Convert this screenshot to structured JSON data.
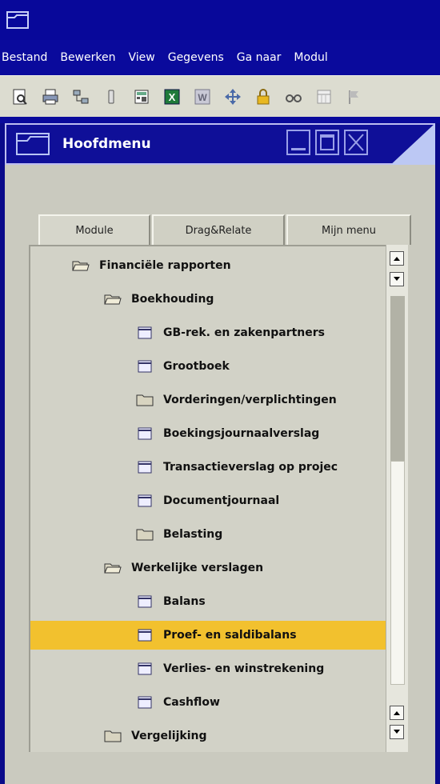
{
  "menubar": {
    "items": [
      "Bestand",
      "Bewerken",
      "View",
      "Gegevens",
      "Ga naar",
      "Modul"
    ]
  },
  "toolbar": {
    "icons": [
      "print-preview-icon",
      "print-icon",
      "network-icon",
      "phone-icon",
      "calculator-icon",
      "excel-icon",
      "word-icon",
      "move-icon",
      "lock-icon",
      "binoculars-icon",
      "calendar-icon",
      "flag-icon"
    ]
  },
  "window": {
    "title": "Hoofdmenu"
  },
  "tabs": [
    {
      "label": "Module",
      "active": true
    },
    {
      "label": "Drag&Relate",
      "active": false
    },
    {
      "label": "Mijn menu",
      "active": false
    }
  ],
  "tree": [
    {
      "label": "Financiële rapporten",
      "icon": "folder-open-icon",
      "level": 0,
      "selected": false
    },
    {
      "label": "Boekhouding",
      "icon": "folder-open-icon",
      "level": 1,
      "selected": false
    },
    {
      "label": "GB-rek. en zakenpartners",
      "icon": "form-icon",
      "level": 2,
      "selected": false
    },
    {
      "label": "Grootboek",
      "icon": "form-icon",
      "level": 2,
      "selected": false
    },
    {
      "label": "Vorderingen/verplichtingen",
      "icon": "folder-closed-icon",
      "level": 2,
      "selected": false
    },
    {
      "label": "Boekingsjournaalverslag",
      "icon": "form-icon",
      "level": 2,
      "selected": false
    },
    {
      "label": "Transactieverslag op projec",
      "icon": "form-icon",
      "level": 2,
      "selected": false
    },
    {
      "label": "Documentjournaal",
      "icon": "form-icon",
      "level": 2,
      "selected": false
    },
    {
      "label": "Belasting",
      "icon": "folder-closed-icon",
      "level": 2,
      "selected": false
    },
    {
      "label": "Werkelijke verslagen",
      "icon": "folder-open-icon",
      "level": 1,
      "selected": false
    },
    {
      "label": "Balans",
      "icon": "form-icon",
      "level": 2,
      "selected": false
    },
    {
      "label": "Proef- en saldibalans",
      "icon": "form-icon",
      "level": 2,
      "selected": true
    },
    {
      "label": "Verlies- en winstrekening",
      "icon": "form-icon",
      "level": 2,
      "selected": false
    },
    {
      "label": "Cashflow",
      "icon": "form-icon",
      "level": 2,
      "selected": false
    },
    {
      "label": "Vergelijking",
      "icon": "folder-closed-icon",
      "level": 1,
      "selected": false
    }
  ],
  "colors": {
    "title_bar": "#08089a",
    "selection": "#f2c12e"
  }
}
